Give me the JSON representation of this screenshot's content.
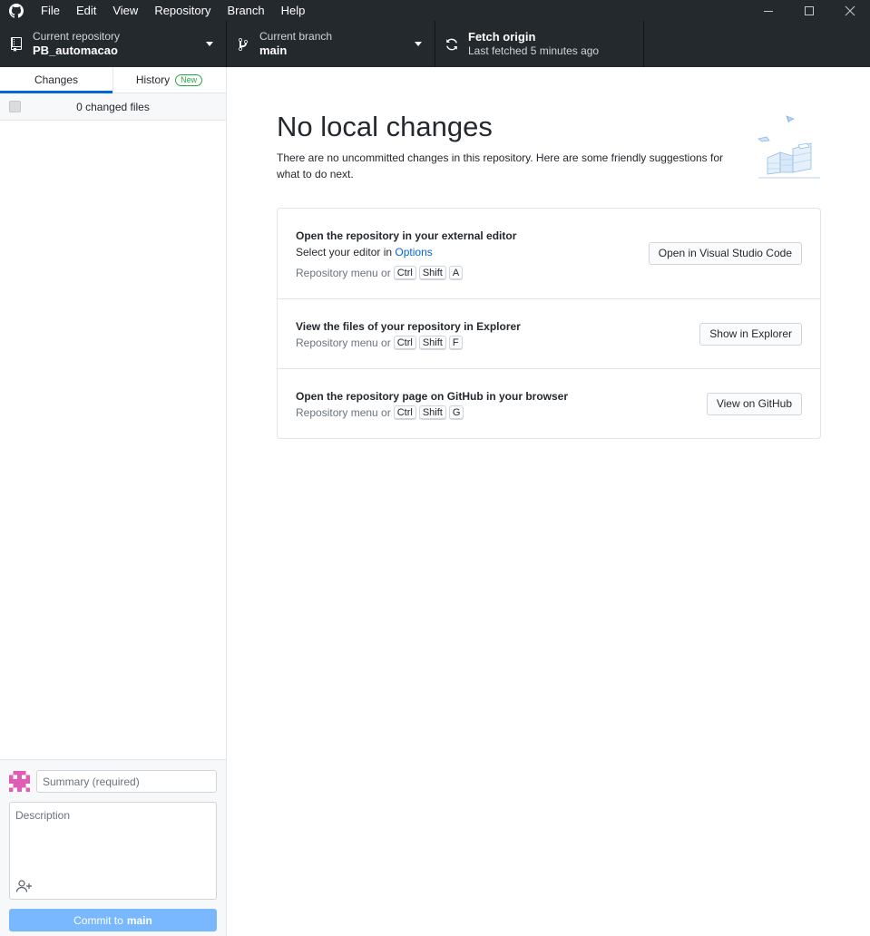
{
  "menu": [
    "File",
    "Edit",
    "View",
    "Repository",
    "Branch",
    "Help"
  ],
  "toolbar": {
    "repo_label": "Current repository",
    "repo_value": "PB_automacao",
    "branch_label": "Current branch",
    "branch_value": "main",
    "fetch_label": "Fetch origin",
    "fetch_value": "Last fetched 5 minutes ago"
  },
  "sidebar": {
    "tabs": [
      {
        "label": "Changes",
        "active": true
      },
      {
        "label": "History",
        "badge": "New"
      }
    ],
    "changed_files": "0 changed files",
    "summary_placeholder": "Summary (required)",
    "description_placeholder": "Description",
    "commit_prefix": "Commit to",
    "commit_branch": "main"
  },
  "main": {
    "title": "No local changes",
    "subtitle": "There are no uncommitted changes in this repository. Here are some friendly suggestions for what to do next.",
    "actions": [
      {
        "title": "Open the repository in your external editor",
        "desc_prefix": "Select your editor in",
        "desc_link": "Options",
        "shortcut_prefix": "Repository menu or",
        "keys": [
          "Ctrl",
          "Shift",
          "A"
        ],
        "button": "Open in Visual Studio Code"
      },
      {
        "title": "View the files of your repository in Explorer",
        "shortcut_prefix": "Repository menu or",
        "keys": [
          "Ctrl",
          "Shift",
          "F"
        ],
        "button": "Show in Explorer"
      },
      {
        "title": "Open the repository page on GitHub in your browser",
        "shortcut_prefix": "Repository menu or",
        "keys": [
          "Ctrl",
          "Shift",
          "G"
        ],
        "button": "View on GitHub"
      }
    ]
  },
  "colors": {
    "toolbar_bg": "#24292e",
    "accent": "#0366d6",
    "badge": "#28a745",
    "commit_button": "#79b8ff"
  },
  "icons": [
    "github-logo-icon",
    "repo-icon",
    "branch-icon",
    "sync-icon",
    "minimize-icon",
    "maximize-icon",
    "close-icon",
    "avatar",
    "add-coauthor-icon"
  ]
}
